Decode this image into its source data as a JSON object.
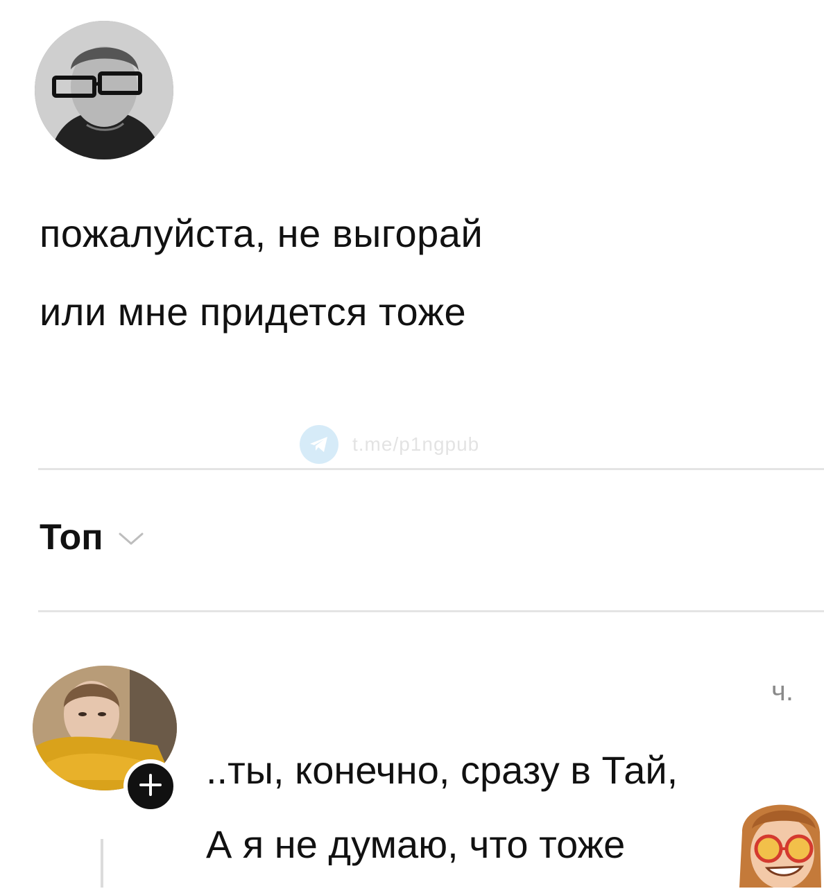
{
  "post": {
    "lines": [
      "пожалуйста, не выгорай",
      "или мне придется тоже"
    ]
  },
  "watermark": {
    "text": "t.me/p1ngpub",
    "icon": "telegram-icon"
  },
  "comments_header": {
    "sort_label": "Топ",
    "sort_icon": "chevron-down-icon"
  },
  "comment": {
    "time": "ч.",
    "lines": [
      "..ты, конечно, сразу в Тай,",
      "А я не думаю, что тоже"
    ],
    "follow_icon": "plus-icon"
  },
  "colors": {
    "background": "#ffffff",
    "text": "#111111",
    "muted": "#8a8a8a",
    "divider": "#e4e4e4",
    "follow_button": "#111111"
  }
}
